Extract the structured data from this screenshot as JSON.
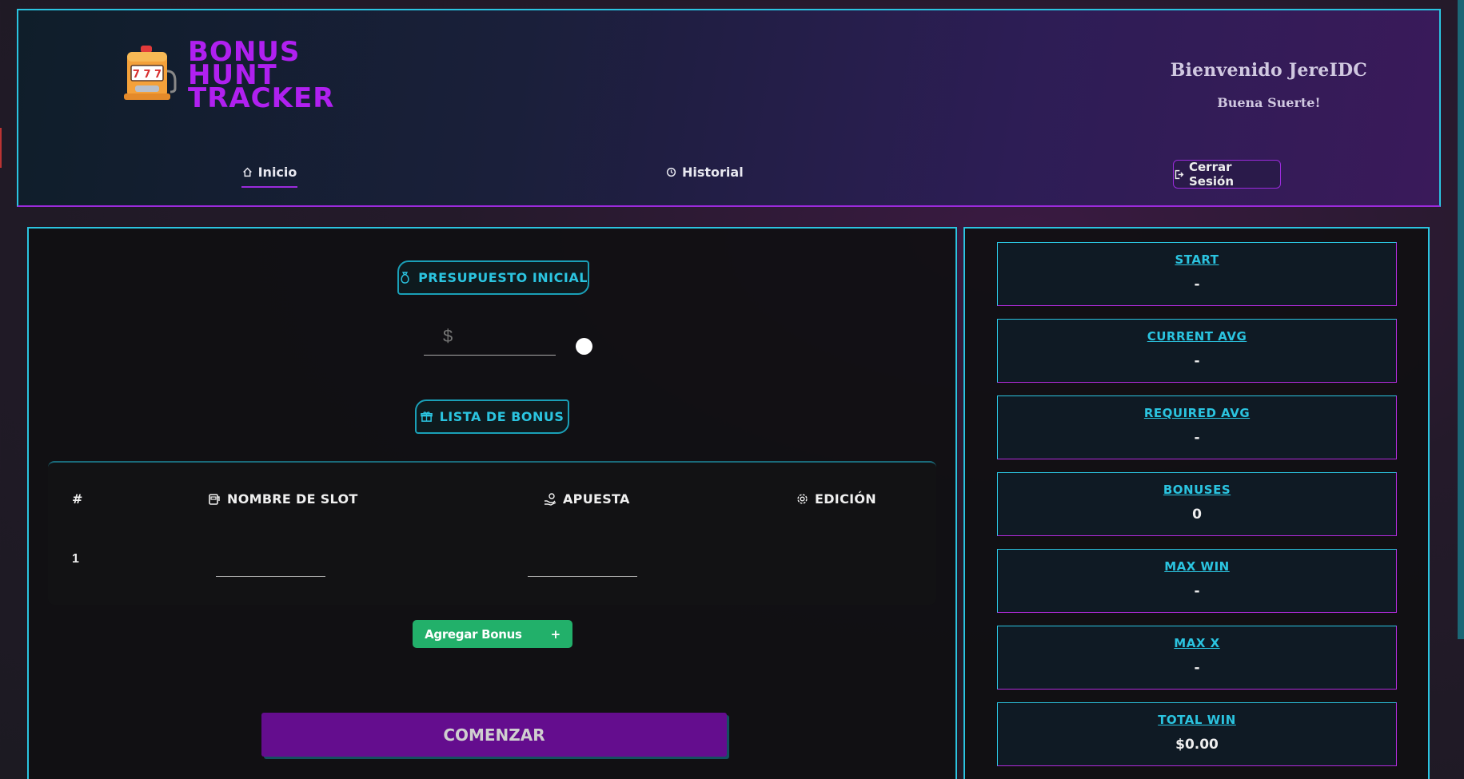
{
  "header": {
    "logo_line1": "BONUS",
    "logo_line2": "HUNT",
    "logo_line3": "TRACKER",
    "welcome": "Bienvenido JereIDC",
    "subtitle": "Buena Suerte!",
    "slot_digits": "7 7 7"
  },
  "nav": {
    "inicio": "Inicio",
    "historial": "Historial",
    "logout": "Cerrar Sesión"
  },
  "main": {
    "budget_label": "PRESUPUESTO INICIAL",
    "budget_placeholder": "$",
    "list_label": "LISTA DE BONUS",
    "table": {
      "col_num": "#",
      "col_slot": "NOMBRE DE SLOT",
      "col_bet": "APUESTA",
      "col_edit": "EDICIÓN",
      "rows": [
        {
          "num": "1",
          "slot": "",
          "bet": ""
        }
      ]
    },
    "add_bonus": "Agregar Bonus",
    "add_plus": "+",
    "start": "COMENZAR"
  },
  "stats": [
    {
      "label": "START",
      "value": "-"
    },
    {
      "label": "CURRENT AVG",
      "value": "-"
    },
    {
      "label": "REQUIRED AVG",
      "value": "-"
    },
    {
      "label": "BONUSES",
      "value": "0"
    },
    {
      "label": "MAX WIN",
      "value": "-"
    },
    {
      "label": "MAX X",
      "value": "-"
    },
    {
      "label": "TOTAL WIN",
      "value": "$0.00"
    }
  ],
  "colors": {
    "accent_cyan": "#2bc4e0",
    "accent_purple": "#9b2bdc",
    "add_green": "#22b06a",
    "start_purple": "#640d8e"
  },
  "icons": {
    "logo": "slot-machine-icon",
    "inicio": "home-icon",
    "historial": "history-icon",
    "logout": "logout-icon",
    "budget": "money-bag-icon",
    "list": "gift-icon",
    "slot": "slot-machine-icon",
    "bet": "hand-coin-icon",
    "edit": "gear-icon"
  }
}
